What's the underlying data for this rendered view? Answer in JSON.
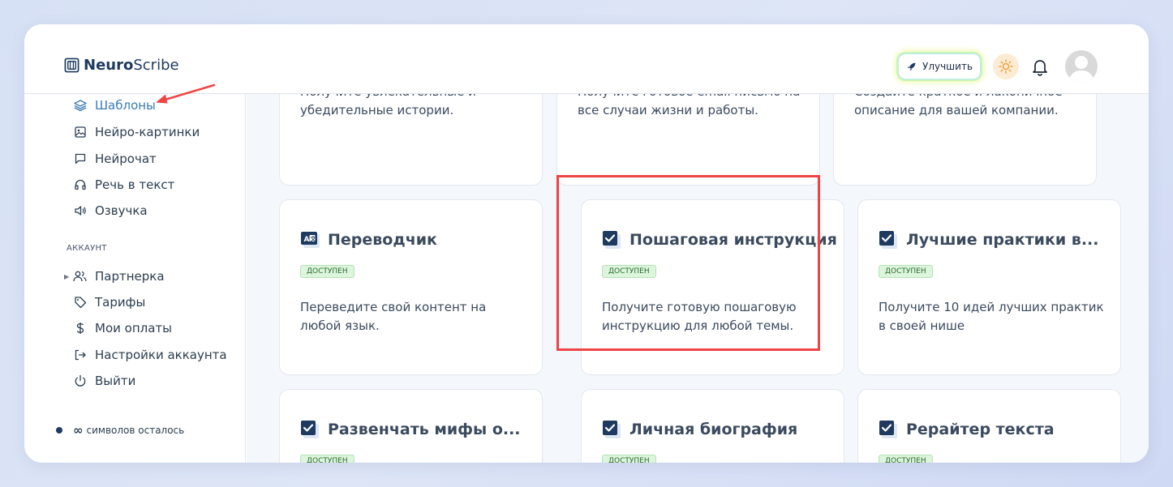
{
  "app": {
    "logo_strong": "Neuro",
    "logo_light": "Scribe"
  },
  "header": {
    "upgrade_label": "Улучшить"
  },
  "sidebar": {
    "items": [
      {
        "label": "Шаблоны",
        "icon": "layers-icon",
        "active": true
      },
      {
        "label": "Нейро-картинки",
        "icon": "image-icon"
      },
      {
        "label": "Нейрочат",
        "icon": "chat-icon"
      },
      {
        "label": "Речь в текст",
        "icon": "headphones-icon"
      },
      {
        "label": "Озвучка",
        "icon": "speaker-icon"
      }
    ],
    "account_label": "АККАУНТ",
    "account_items": [
      {
        "label": "Партнерка",
        "icon": "users-icon"
      },
      {
        "label": "Тарифы",
        "icon": "tag-icon"
      },
      {
        "label": "Мои оплаты",
        "icon": "dollar-icon"
      },
      {
        "label": "Настройки аккаунта",
        "icon": "logout-arrow-icon"
      },
      {
        "label": "Выйти",
        "icon": "power-icon"
      }
    ],
    "chars_infinity": "∞",
    "chars_label": "символов осталось"
  },
  "cards_top": [
    {
      "desc_partial": "Получите увлекательные и",
      "desc": "убедительные истории."
    },
    {
      "desc_partial": "Получите готовое email письмо на",
      "desc": "все случаи жизни и работы."
    },
    {
      "desc_partial": "Создайте краткое и лаконичное",
      "desc": "описание для вашей компании."
    }
  ],
  "cards_mid": [
    {
      "title": "Переводчик",
      "badge": "ДОСТУПЕН",
      "desc": "Переведите свой контент на любой язык.",
      "icon": "translate-icon"
    },
    {
      "title": "Пошаговая инструкция",
      "badge": "ДОСТУПЕН",
      "desc": "Получите готовую пошаговую инструкцию для любой темы.",
      "icon": "checkbox-icon"
    },
    {
      "title": "Лучшие практики в...",
      "badge": "ДОСТУПЕН",
      "desc": "Получите 10 идей лучших практик в своей нише",
      "icon": "checkbox-icon"
    }
  ],
  "cards_bottom": [
    {
      "title": "Развенчать мифы о...",
      "badge": "ДОСТУПЕН",
      "icon": "checkbox-icon"
    },
    {
      "title": "Личная биография",
      "badge": "ДОСТУПЕН",
      "icon": "checkbox-icon"
    },
    {
      "title": "Рерайтер текста",
      "badge": "ДОСТУПЕН",
      "icon": "checkbox-icon"
    }
  ],
  "colors": {
    "accent": "#3a7bb5",
    "highlight": "#ef4444",
    "badge_bg": "#dcf5dc"
  }
}
